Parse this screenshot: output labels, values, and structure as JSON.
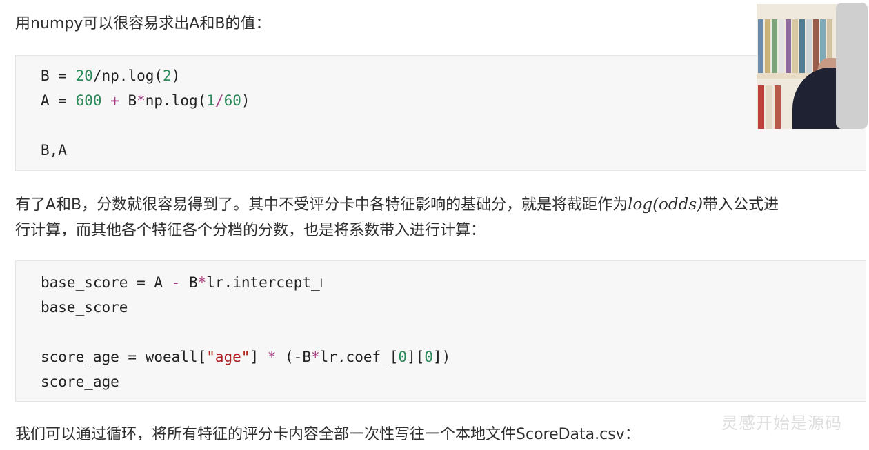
{
  "text": {
    "intro": "用numpy可以很容易求出A和B的值：",
    "middle_line1_pre": "有了A和B，分数就很容易得到了。其中不受评分卡中各特征影响的基础分，就是将截距作为",
    "middle_math": "log(odds)",
    "middle_line1_post": "带入公式进",
    "middle_line2": "行计算，而其他各个特征各个分档的分数，也是将系数带入进行计算：",
    "closing": "我们可以通过循环，将所有特征的评分卡内容全部一次性写往一个本地文件ScoreData.csv："
  },
  "code1": {
    "l1_var": "B = ",
    "l1_num1": "20",
    "l1_mid": "/np.log(",
    "l1_num2": "2",
    "l1_end": ")",
    "l2_var": "A = ",
    "l2_num1": "600",
    "l2_op": " + ",
    "l2_mid": "B",
    "l2_star": "*",
    "l2_call": "np.log(",
    "l2_num2": "1",
    "l2_slash": "/",
    "l2_num3": "60",
    "l2_end": ")",
    "l3": "B,A"
  },
  "code2": {
    "l1_a": "base_score = A ",
    "l1_op": "-",
    "l1_b": " B",
    "l1_star": "*",
    "l1_c": "lr.intercept_",
    "l2": "base_score",
    "l3_a": "score_age = woeall[",
    "l3_str": "\"age\"",
    "l3_b": "] ",
    "l3_op": "*",
    "l3_c": " (-B",
    "l3_star": "*",
    "l3_d": "lr.coef_[",
    "l3_n1": "0",
    "l3_e": "][",
    "l3_n2": "0",
    "l3_f": "])",
    "l4": "score_age"
  },
  "watermark": "灵感开始是源码",
  "icons": {
    "text_cursor": "I"
  },
  "colors": {
    "number": "#2a8a5a",
    "operator": "#a23b7e",
    "string": "#b22222",
    "code_bg": "#f7f7f7"
  }
}
